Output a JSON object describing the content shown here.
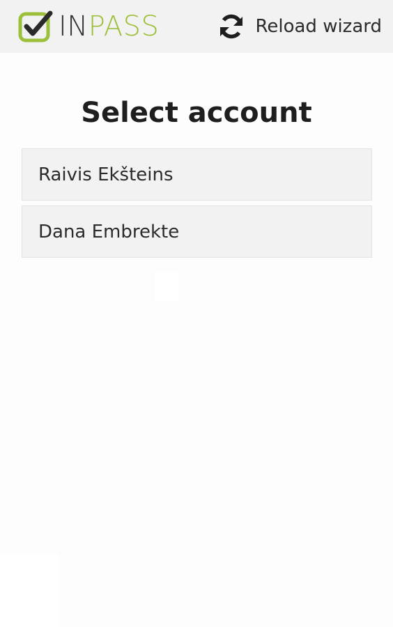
{
  "header": {
    "logo": {
      "icon": "checkbox-check-icon",
      "text_in": "IN",
      "text_pass": "PASS",
      "color_accent": "#9cc03c",
      "color_dark": "#333333"
    },
    "reload": {
      "icon": "refresh-icon",
      "label": "Reload wizard"
    }
  },
  "main": {
    "title": "Select account",
    "accounts": [
      {
        "name": "Raivis Ekšteins"
      },
      {
        "name": "Dana Embrekte"
      }
    ]
  }
}
